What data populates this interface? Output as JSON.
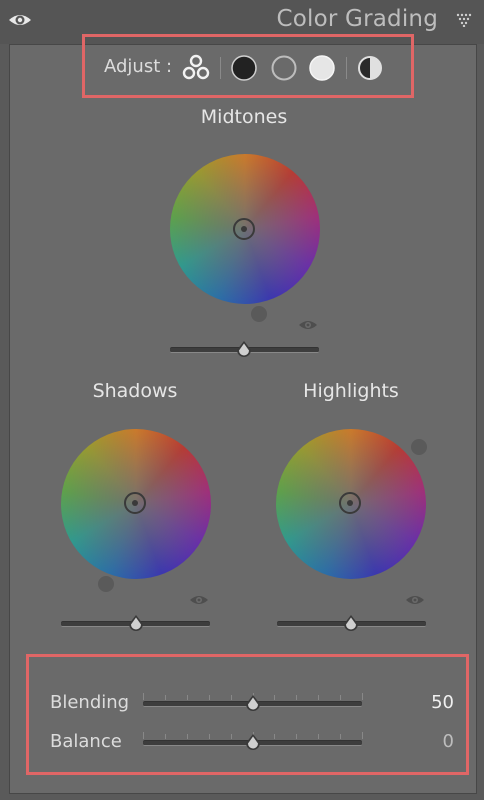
{
  "header": {
    "title": "Color Grading"
  },
  "adjust": {
    "label": "Adjust :",
    "modes": [
      "3-way",
      "shadows",
      "midtones",
      "highlights",
      "global"
    ]
  },
  "wheels": {
    "midtones": {
      "title": "Midtones",
      "luminance": 0.5
    },
    "shadows": {
      "title": "Shadows",
      "luminance": 0.5
    },
    "highlights": {
      "title": "Highlights",
      "luminance": 0.5
    }
  },
  "sliders": {
    "blending": {
      "label": "Blending",
      "value": "50",
      "position": 0.5
    },
    "balance": {
      "label": "Balance",
      "value": "0",
      "position": 0.5
    }
  },
  "colors": {
    "highlight_border": "#e06666",
    "panel_bg": "#6a6a6a"
  }
}
